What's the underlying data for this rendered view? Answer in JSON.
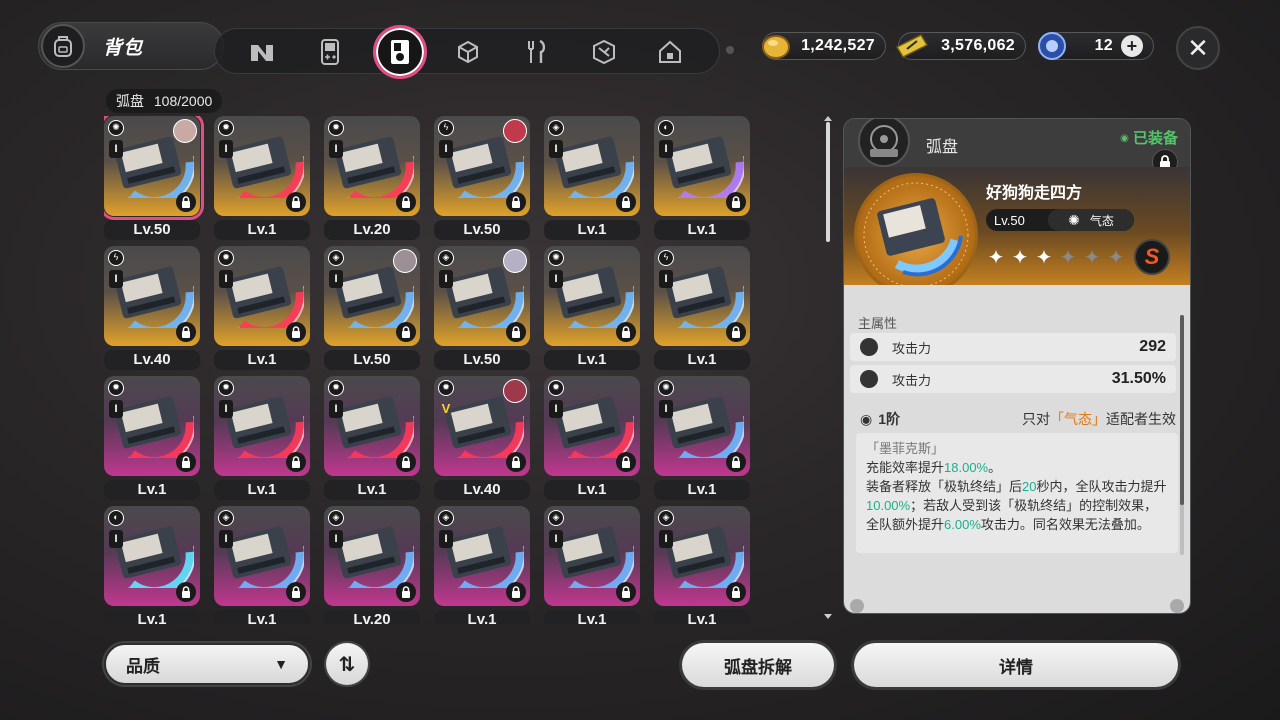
{
  "header": {
    "bag_title": "背包",
    "tabs": [
      {
        "icon": "n-logo-icon",
        "active": false
      },
      {
        "icon": "gameboy-icon",
        "active": false
      },
      {
        "icon": "disc-drive-icon",
        "active": true
      },
      {
        "icon": "cube-icon",
        "active": false
      },
      {
        "icon": "fork-knife-icon",
        "active": false
      },
      {
        "icon": "shield-tool-icon",
        "active": false
      },
      {
        "icon": "home-icon",
        "active": false
      }
    ],
    "currencies": [
      {
        "icon": "gold-coin-icon",
        "value": "1,242,527"
      },
      {
        "icon": "ticket-icon",
        "value": "3,576,062"
      },
      {
        "icon": "energy-orb-icon",
        "value": "12"
      }
    ]
  },
  "inventory": {
    "label": "弧盘",
    "count": "108/2000",
    "rows": [
      [
        {
          "lvl": "Lv.50",
          "rarity": "gold",
          "ring": "blue",
          "type": "✺",
          "rank": "I",
          "avatar": "#c9a9a4",
          "selected": true
        },
        {
          "lvl": "Lv.1",
          "rarity": "gold",
          "ring": "red",
          "type": "✹",
          "rank": "I"
        },
        {
          "lvl": "Lv.20",
          "rarity": "gold",
          "ring": "red",
          "type": "✹",
          "rank": "I"
        },
        {
          "lvl": "Lv.50",
          "rarity": "gold",
          "ring": "blue",
          "type": "ϟ",
          "rank": "I",
          "avatar": "#c03a4c"
        },
        {
          "lvl": "Lv.1",
          "rarity": "gold",
          "ring": "blue",
          "type": "◈",
          "rank": "I"
        },
        {
          "lvl": "Lv.1",
          "rarity": "gold",
          "ring": "purple",
          "type": "◐",
          "rank": "I"
        }
      ],
      [
        {
          "lvl": "Lv.40",
          "rarity": "gold",
          "ring": "blue",
          "type": "ϟ",
          "rank": "I"
        },
        {
          "lvl": "Lv.1",
          "rarity": "gold",
          "ring": "red",
          "type": "✹",
          "rank": "I"
        },
        {
          "lvl": "Lv.50",
          "rarity": "gold",
          "ring": "blue",
          "type": "◈",
          "rank": "I",
          "avatar": "#9c8f95"
        },
        {
          "lvl": "Lv.50",
          "rarity": "gold",
          "ring": "blue",
          "type": "◈",
          "rank": "I",
          "avatar": "#b5b0c4"
        },
        {
          "lvl": "Lv.1",
          "rarity": "gold",
          "ring": "blue",
          "type": "✺",
          "rank": "I"
        },
        {
          "lvl": "Lv.1",
          "rarity": "gold",
          "ring": "blue",
          "type": "ϟ",
          "rank": "I"
        }
      ],
      [
        {
          "lvl": "Lv.1",
          "rarity": "pink",
          "ring": "red",
          "type": "✹",
          "rank": "I"
        },
        {
          "lvl": "Lv.1",
          "rarity": "pink",
          "ring": "red",
          "type": "✹",
          "rank": "I"
        },
        {
          "lvl": "Lv.1",
          "rarity": "pink",
          "ring": "red",
          "type": "✹",
          "rank": "I"
        },
        {
          "lvl": "Lv.40",
          "rarity": "pink",
          "ring": "red",
          "type": "✹",
          "rank": "V",
          "avatar": "#a0384c"
        },
        {
          "lvl": "Lv.1",
          "rarity": "pink",
          "ring": "red",
          "type": "✹",
          "rank": "I"
        },
        {
          "lvl": "Lv.1",
          "rarity": "pink",
          "ring": "blue",
          "type": "✺",
          "rank": "I"
        }
      ],
      [
        {
          "lvl": "Lv.1",
          "rarity": "pink",
          "ring": "cyan",
          "type": "◐",
          "rank": "I"
        },
        {
          "lvl": "Lv.1",
          "rarity": "pink",
          "ring": "blue",
          "type": "◈",
          "rank": "I"
        },
        {
          "lvl": "Lv.20",
          "rarity": "pink",
          "ring": "blue",
          "type": "◈",
          "rank": "I"
        },
        {
          "lvl": "Lv.1",
          "rarity": "pink",
          "ring": "blue",
          "type": "◈",
          "rank": "I"
        },
        {
          "lvl": "Lv.1",
          "rarity": "pink",
          "ring": "blue",
          "type": "◈",
          "rank": "I"
        },
        {
          "lvl": "Lv.1",
          "rarity": "pink",
          "ring": "blue",
          "type": "◈",
          "rank": "I"
        }
      ]
    ]
  },
  "footer": {
    "sort_label": "品质",
    "sort_order_icon": "sort-order-icon",
    "dismantle_label": "弧盘拆解",
    "details_label": "详情"
  },
  "detail": {
    "category": "弧盘",
    "equipped": "已装备",
    "name": "好狗狗走四方",
    "level": "Lv.50",
    "attribute": "气态",
    "stars_filled": 3,
    "stars_total": 6,
    "rank": "S",
    "main_attr_label": "主属性",
    "stats": [
      {
        "label": "攻击力",
        "value": "292"
      },
      {
        "label": "攻击力",
        "value": "31.50%"
      }
    ],
    "effect": {
      "tier": "1阶",
      "condition_prefix": "只对",
      "condition_attr": "「气态」",
      "condition_suffix": "适配者生效",
      "set_name": "「墨菲克斯」",
      "line1_a": "充能效率提升",
      "line1_b": "18.00%",
      "line1_c": "。",
      "line2_a": "装备者释放「极轨终结」后",
      "line2_b": "20",
      "line2_c": "秒内，全队攻击力提升",
      "line2_d": "10.00%",
      "line2_e": "；若敌人受到该「极轨终结」的控制效果，全队额外提升",
      "line2_f": "6.00%",
      "line2_g": "攻击力。同名效果无法叠加。"
    }
  },
  "colors": {
    "accent": "#e24d86",
    "gold_card": "#e0a12a",
    "pink_card": "#c0388f",
    "green": "#1bb090",
    "orange": "#e07a16"
  }
}
